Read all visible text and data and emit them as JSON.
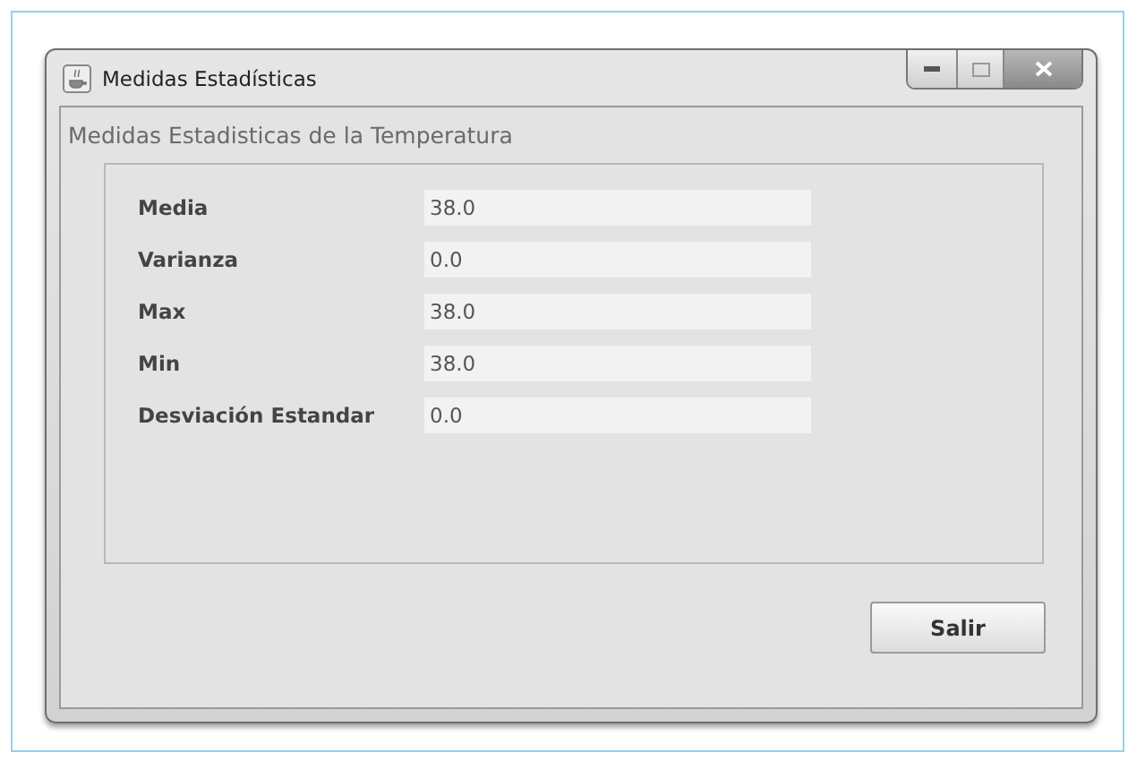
{
  "window": {
    "title": "Medidas Estadísticas"
  },
  "section_title": "Medidas Estadisticas de la Temperatura",
  "fields": [
    {
      "label": "Media",
      "value": "38.0"
    },
    {
      "label": "Varianza",
      "value": "0.0"
    },
    {
      "label": "Max",
      "value": "38.0"
    },
    {
      "label": "Min",
      "value": "38.0"
    },
    {
      "label": "Desviación Estandar",
      "value": "0.0"
    }
  ],
  "buttons": [
    "Salir"
  ]
}
